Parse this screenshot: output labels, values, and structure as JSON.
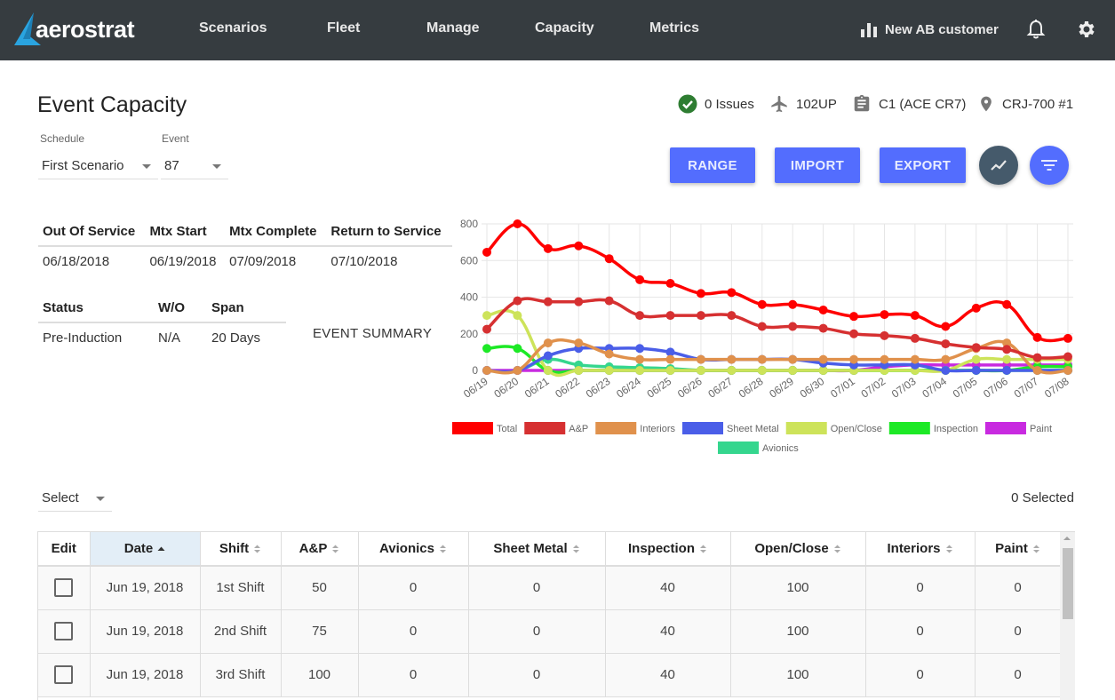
{
  "app": {
    "logo_text": "aerostrat",
    "nav": [
      "Scenarios",
      "Fleet",
      "Manage",
      "Capacity",
      "Metrics"
    ],
    "customer": "New AB customer"
  },
  "page": {
    "title": "Event Capacity",
    "schedule_label": "Schedule",
    "schedule_value": "First Scenario",
    "event_label": "Event",
    "event_value": "87"
  },
  "info": {
    "issues": "0 Issues",
    "aircraft": "102UP",
    "check": "C1 (ACE CR7)",
    "location": "CRJ-700 #1"
  },
  "actions": {
    "range": "RANGE",
    "import": "IMPORT",
    "export": "EXPORT"
  },
  "summary": {
    "dates_headers": [
      "Out Of Service",
      "Mtx Start",
      "Mtx Complete",
      "Return to Service"
    ],
    "dates_values": [
      "06/18/2018",
      "06/19/2018",
      "07/09/2018",
      "07/10/2018"
    ],
    "status_headers": [
      "Status",
      "W/O",
      "Span"
    ],
    "status_values": [
      "Pre-Induction",
      "N/A",
      "20 Days"
    ],
    "event_summary_label": "EVENT SUMMARY"
  },
  "chart_data": {
    "type": "line",
    "title": "",
    "xlabel": "",
    "ylabel": "",
    "ylim": [
      0,
      800
    ],
    "yticks": [
      0,
      200,
      400,
      600,
      800
    ],
    "grid": true,
    "legend_position": "bottom",
    "x": [
      "06/19",
      "06/20",
      "06/21",
      "06/22",
      "06/23",
      "06/24",
      "06/25",
      "06/26",
      "06/27",
      "06/28",
      "06/29",
      "06/30",
      "07/01",
      "07/02",
      "07/03",
      "07/04",
      "07/05",
      "07/06",
      "07/07",
      "07/08"
    ],
    "series": [
      {
        "name": "Total",
        "color": "#ff0000",
        "values": [
          645,
          800,
          665,
          680,
          610,
          495,
          475,
          420,
          425,
          360,
          360,
          330,
          295,
          305,
          300,
          240,
          340,
          360,
          180,
          175
        ]
      },
      {
        "name": "A&P",
        "color": "#d63031",
        "values": [
          225,
          380,
          375,
          375,
          380,
          300,
          300,
          300,
          300,
          240,
          240,
          230,
          200,
          190,
          175,
          145,
          125,
          115,
          70,
          75
        ]
      },
      {
        "name": "Interiors",
        "color": "#e0914c",
        "values": [
          0,
          0,
          150,
          150,
          90,
          60,
          60,
          60,
          60,
          60,
          60,
          60,
          60,
          60,
          60,
          60,
          120,
          150,
          0,
          0
        ]
      },
      {
        "name": "Sheet Metal",
        "color": "#4a5ee8",
        "values": [
          0,
          0,
          80,
          120,
          120,
          120,
          100,
          60,
          60,
          60,
          60,
          40,
          30,
          30,
          30,
          0,
          0,
          0,
          0,
          0
        ]
      },
      {
        "name": "Open/Close",
        "color": "#cde35a",
        "values": [
          300,
          300,
          0,
          0,
          0,
          0,
          0,
          0,
          0,
          0,
          0,
          0,
          0,
          0,
          0,
          0,
          60,
          60,
          60,
          60
        ]
      },
      {
        "name": "Inspection",
        "color": "#1de926",
        "values": [
          120,
          120,
          0,
          0,
          0,
          0,
          0,
          0,
          0,
          0,
          0,
          0,
          0,
          0,
          0,
          0,
          0,
          0,
          20,
          20
        ]
      },
      {
        "name": "Paint",
        "color": "#c82ae0",
        "values": [
          0,
          0,
          0,
          0,
          0,
          0,
          0,
          0,
          0,
          0,
          0,
          0,
          0,
          20,
          30,
          30,
          30,
          30,
          30,
          30
        ]
      },
      {
        "name": "Avionics",
        "color": "#35d68e",
        "values": [
          0,
          0,
          60,
          30,
          20,
          15,
          10,
          0,
          0,
          0,
          0,
          0,
          0,
          0,
          0,
          0,
          0,
          0,
          0,
          0
        ]
      }
    ]
  },
  "table": {
    "bulk_select": "Select",
    "selected_count": "0 Selected",
    "columns": [
      "Edit",
      "Date",
      "Shift",
      "A&P",
      "Avionics",
      "Sheet Metal",
      "Inspection",
      "Open/Close",
      "Interiors",
      "Paint"
    ],
    "sorted_column": "Date",
    "rows": [
      {
        "date": "Jun 19, 2018",
        "shift": "1st Shift",
        "ap": "50",
        "avionics": "0",
        "sheet_metal": "0",
        "inspection": "40",
        "open_close": "100",
        "interiors": "0",
        "paint": "0"
      },
      {
        "date": "Jun 19, 2018",
        "shift": "2nd Shift",
        "ap": "75",
        "avionics": "0",
        "sheet_metal": "0",
        "inspection": "40",
        "open_close": "100",
        "interiors": "0",
        "paint": "0"
      },
      {
        "date": "Jun 19, 2018",
        "shift": "3rd Shift",
        "ap": "100",
        "avionics": "0",
        "sheet_metal": "0",
        "inspection": "40",
        "open_close": "100",
        "interiors": "0",
        "paint": "0"
      }
    ]
  }
}
